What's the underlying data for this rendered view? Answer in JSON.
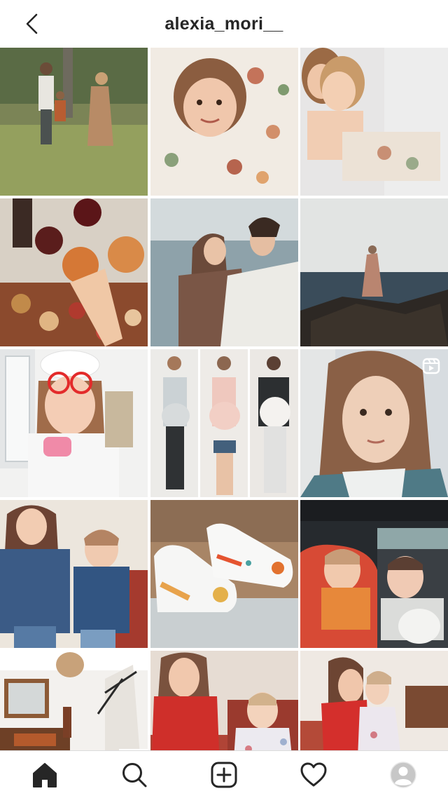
{
  "header": {
    "title": "alexia_mori__",
    "back_icon": "chevron-left-icon"
  },
  "grid": {
    "posts": [
      {
        "id": "post-1",
        "subject": "family-in-park"
      },
      {
        "id": "post-2",
        "subject": "girl-in-floral-bedding"
      },
      {
        "id": "post-3",
        "subject": "two-girls-hugging"
      },
      {
        "id": "post-4",
        "subject": "toast-with-drinks"
      },
      {
        "id": "post-5",
        "subject": "couple-by-sea"
      },
      {
        "id": "post-6",
        "subject": "woman-on-rocks-by-sea"
      },
      {
        "id": "post-7",
        "subject": "girl-doctor-costume"
      },
      {
        "id": "post-8",
        "subject": "pregnancy-progress-triptych"
      },
      {
        "id": "post-9",
        "subject": "woman-selfie",
        "type": "reel",
        "icon": "reel-icon"
      },
      {
        "id": "post-10",
        "subject": "two-girls-in-denim"
      },
      {
        "id": "post-11",
        "subject": "custom-baby-sneakers"
      },
      {
        "id": "post-12",
        "subject": "kids-in-car-seats"
      },
      {
        "id": "post-13",
        "subject": "entrance-hallway"
      },
      {
        "id": "post-14",
        "subject": "girls-red-and-floral-dresses"
      },
      {
        "id": "post-15",
        "subject": "girls-kissing"
      }
    ]
  },
  "bottom_nav": {
    "items": [
      {
        "name": "home",
        "icon": "home-icon",
        "active": true
      },
      {
        "name": "search",
        "icon": "search-icon"
      },
      {
        "name": "new-post",
        "icon": "plus-square-icon"
      },
      {
        "name": "activity",
        "icon": "heart-icon"
      },
      {
        "name": "profile",
        "icon": "avatar-icon"
      }
    ]
  },
  "colors": {
    "text": "#262626",
    "divider": "#dbdbdb",
    "background": "#ffffff"
  }
}
